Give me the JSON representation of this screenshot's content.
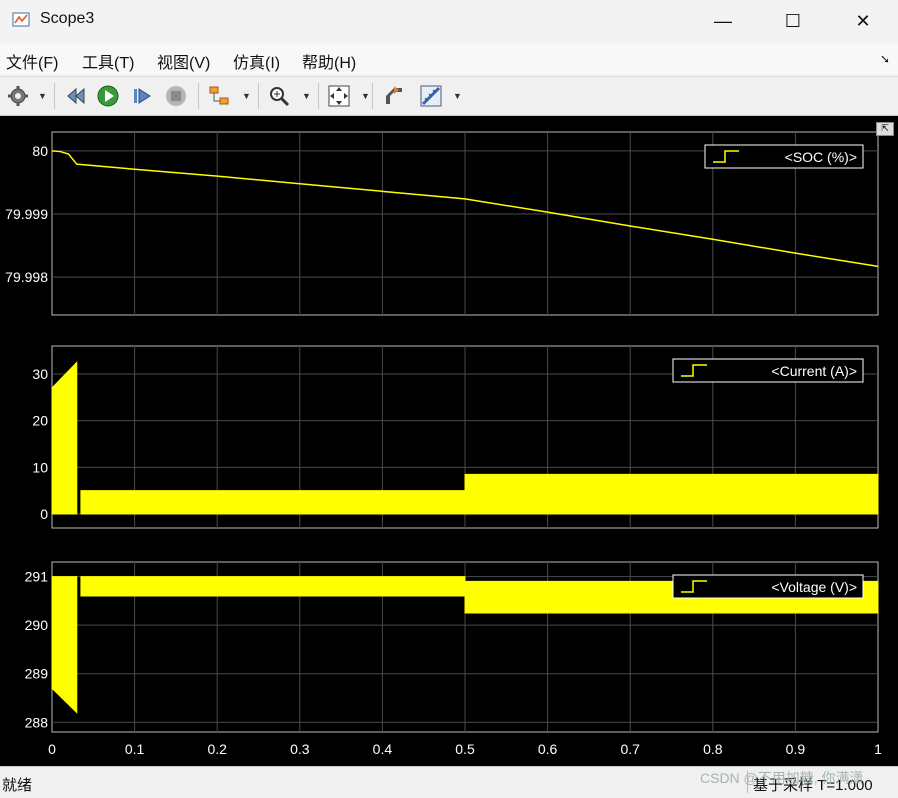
{
  "window": {
    "title": "Scope3",
    "minimize": "—",
    "maximize": "☐",
    "close": "✕"
  },
  "menu": {
    "items": [
      "文件(F)",
      "工具(T)",
      "视图(V)",
      "仿真(I)",
      "帮助(H)"
    ],
    "corner": "➘"
  },
  "toolbar": {
    "icons": [
      "gear-icon",
      "rewind-icon",
      "run-icon",
      "step-forward-icon",
      "stop-icon",
      "highlight-block-icon",
      "zoom-icon",
      "fit-to-view-icon",
      "autoscale-icon",
      "measurement-icon"
    ]
  },
  "status": {
    "left": "就绪",
    "right": "基于采样 T=1.000"
  },
  "watermark": "CSDN @不用加糖, 你满潇",
  "colors": {
    "plot_bg": "#000000",
    "trace": "#ffff00",
    "grid": "#4a4a4a",
    "axes_text": "#ffffff",
    "frame": "#bdbdbd"
  },
  "chart_data": [
    {
      "type": "line",
      "legend": "<SOC (%)>",
      "legend_position": "top-right",
      "ylim": [
        79.9974,
        80.0003
      ],
      "xlim": [
        0,
        1
      ],
      "yticks": [
        80,
        79.999,
        79.998
      ],
      "ytick_labels": [
        "80",
        "79.999",
        "79.998"
      ],
      "x": [
        0,
        0.01,
        0.02,
        0.03,
        0.1,
        0.2,
        0.3,
        0.4,
        0.5,
        0.6,
        0.7,
        0.8,
        0.9,
        1.0
      ],
      "y": [
        80.0,
        79.99999,
        79.99995,
        79.99979,
        79.99971,
        79.9996,
        79.99948,
        79.99936,
        79.99924,
        79.99903,
        79.99881,
        79.9986,
        79.99838,
        79.99817
      ]
    },
    {
      "type": "line",
      "legend": "<Current (A)>",
      "legend_position": "top-right",
      "ylim": [
        -3,
        36
      ],
      "xlim": [
        0,
        1
      ],
      "yticks": [
        0,
        10,
        20,
        30
      ],
      "ytick_labels": [
        "0",
        "10",
        "20",
        "30"
      ],
      "segments": [
        {
          "x0": 0.0,
          "x1": 0.03,
          "min": 0,
          "max_start": 27,
          "max_end": 32.5
        },
        {
          "x0": 0.035,
          "x1": 0.5,
          "min": 0,
          "max": 5
        },
        {
          "x0": 0.5,
          "x1": 1.0,
          "min": 0,
          "max": 8.5
        }
      ]
    },
    {
      "type": "line",
      "legend": "<Voltage (V)>",
      "legend_position": "top-right",
      "ylim": [
        287.8,
        291.3
      ],
      "xlim": [
        0,
        1
      ],
      "yticks": [
        288,
        289,
        290,
        291
      ],
      "ytick_labels": [
        "288",
        "289",
        "290",
        "291"
      ],
      "xticks": [
        0,
        0.1,
        0.2,
        0.3,
        0.4,
        0.5,
        0.6,
        0.7,
        0.8,
        0.9,
        1
      ],
      "xtick_labels": [
        "0",
        "0.1",
        "0.2",
        "0.3",
        "0.4",
        "0.5",
        "0.6",
        "0.7",
        "0.8",
        "0.9",
        "1"
      ],
      "segments": [
        {
          "x0": 0.0,
          "x1": 0.03,
          "max": 291.0,
          "min_start": 288.7,
          "min_end": 288.2
        },
        {
          "x0": 0.035,
          "x1": 0.5,
          "max": 291.0,
          "min": 290.6
        },
        {
          "x0": 0.5,
          "x1": 1.0,
          "max": 290.9,
          "min": 290.25
        }
      ]
    }
  ]
}
